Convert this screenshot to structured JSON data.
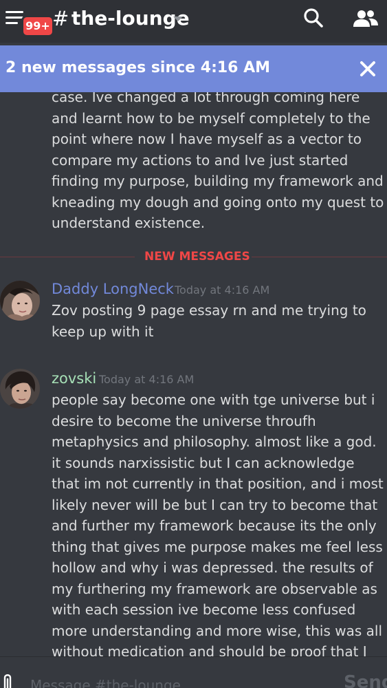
{
  "header": {
    "badge": "99+",
    "hash": "#",
    "channel_name": "the-lounge"
  },
  "new_messages_bar": {
    "text": "2 new messages since 4:16 AM"
  },
  "continued_message": {
    "body": "case. Ive changed a lot through coming here and learnt how to be myself completely to the point where now I have myself as a vector to compare my actions to and Ive just started finding my purpose, building my framework and kneading my dough and going onto my quest to understand existence."
  },
  "divider": {
    "label": "NEW MESSAGES"
  },
  "messages": [
    {
      "username": "Daddy LongNeck",
      "username_color": "#7289da",
      "timestamp": "Today at 4:16 AM",
      "body": "Zov posting 9 page essay rn and me trying to keep up with it"
    },
    {
      "username": "zovski",
      "username_color": "#a6e0b6",
      "timestamp": "Today at 4:16 AM",
      "body": "people say become one with tge universe but i desire to become the universe throufh metaphysics and philosophy. almost like a god. it sounds narxissistic but I can acknowledge that im not currently in that position, and i most likely never will be but I can try to become that and further my framework because its the only thing that gives me purpose makes me feel less hollow and why i was depressed. the results of my furthering my framework are observable as with each session ive become less confused more understanding and more wise, this was all without medication and should be proof that I"
    }
  ],
  "composer": {
    "placeholder": "Message #the-lounge",
    "send_label": "Send"
  },
  "colors": {
    "background": "#36393f",
    "header": "#2f3136",
    "new_bar": "#7289da",
    "new_messages_red": "#f04747"
  }
}
